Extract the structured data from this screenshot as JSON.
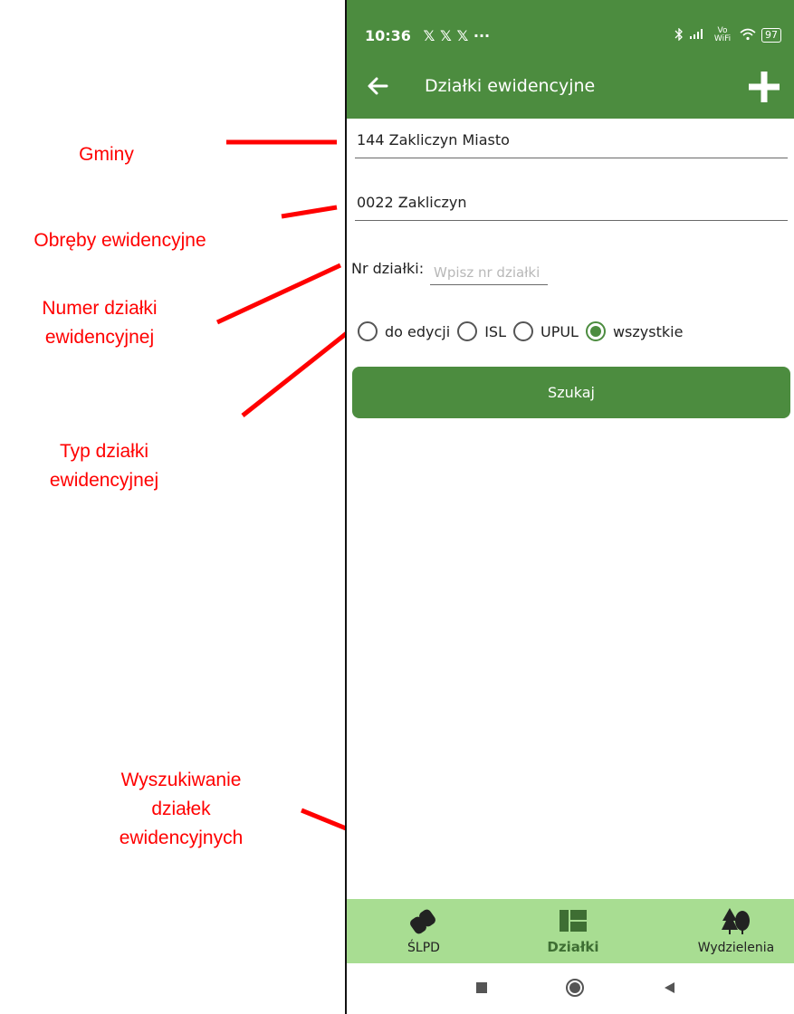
{
  "annotations": {
    "gminy": "Gminy",
    "obreby": "Obręby ewidencyjne",
    "numer_line1": "Numer działki",
    "numer_line2": "ewidencyjnej",
    "typ_line1": "Typ działki",
    "typ_line2": "ewidencyjnej",
    "wysz_line1": "Wyszukiwanie",
    "wysz_line2": "działek",
    "wysz_line3": "ewidencyjnych",
    "color": "#ff0000"
  },
  "status_bar": {
    "time": "10:36",
    "notification_icons": "𝕏 𝕏 𝕏 ···",
    "signal_text": "Vo WiFi",
    "battery": "97"
  },
  "header": {
    "title": "Działki ewidencyjne",
    "back_icon": "arrow-left-icon",
    "add_icon": "plus-icon"
  },
  "form": {
    "gmina_value": "144 Zakliczyn Miasto",
    "obreb_value": "0022 Zakliczyn",
    "nr_label": "Nr działki:",
    "nr_placeholder": "Wpisz nr działki",
    "radio_options": [
      "do edycji",
      "ISL",
      "UPUL",
      "wszystkie"
    ],
    "radio_selected": "wszystkie",
    "search_button": "Szukaj"
  },
  "bottom_nav": {
    "items": [
      {
        "label": "ŚLPD",
        "icon": "binoculars-icon",
        "active": false
      },
      {
        "label": "Działki",
        "icon": "grid-map-icon",
        "active": true
      },
      {
        "label": "Wydzielenia",
        "icon": "trees-icon",
        "active": false
      }
    ]
  },
  "system_nav": [
    "recents-square-icon",
    "home-circle-icon",
    "back-triangle-icon"
  ],
  "colors": {
    "primary_green": "#4c8c3f",
    "nav_background": "#a8dd92",
    "annotation_red": "#ff0000"
  }
}
